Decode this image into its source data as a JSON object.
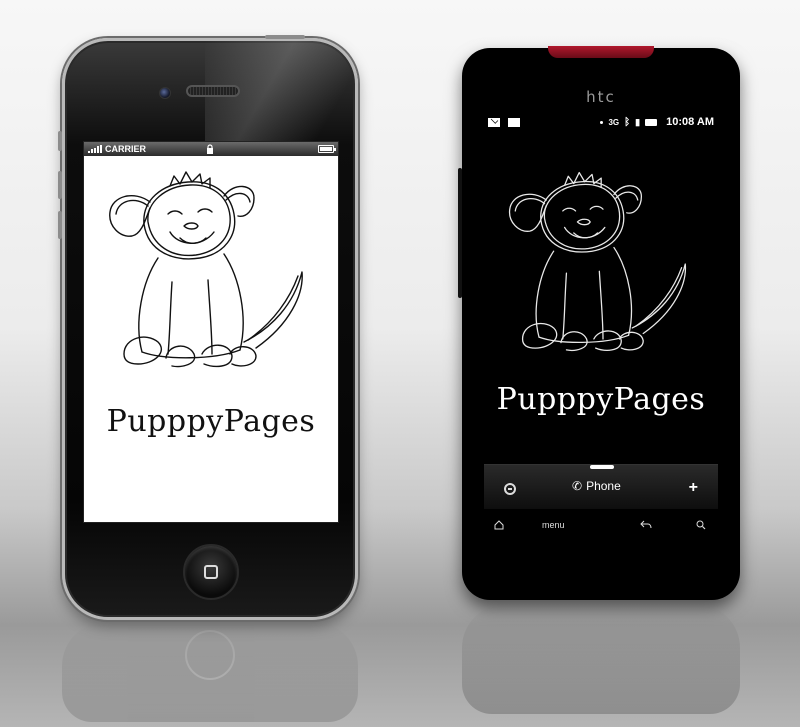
{
  "app": {
    "name": "PupppyPages"
  },
  "iphone": {
    "carrier": "CARRIER"
  },
  "htc": {
    "brand": "htc",
    "time": "10:08 AM",
    "dock_label": "Phone",
    "menu_label": "menu"
  },
  "icons": {
    "signal": "signal-bars-icon",
    "lock": "lock-icon",
    "battery": "battery-icon",
    "mail": "mail-icon",
    "message": "sms-icon",
    "bluetooth": "bluetooth-icon",
    "network": "network-icon",
    "home": "home-icon",
    "back": "back-arrow-icon",
    "search": "search-icon",
    "phone": "phone-handset-icon",
    "add": "plus-icon",
    "minus": "circle-minus-icon"
  },
  "colors": {
    "htc_accent": "#9b1a2b",
    "iphone_screen": "#ffffff",
    "htc_screen": "#000000"
  }
}
